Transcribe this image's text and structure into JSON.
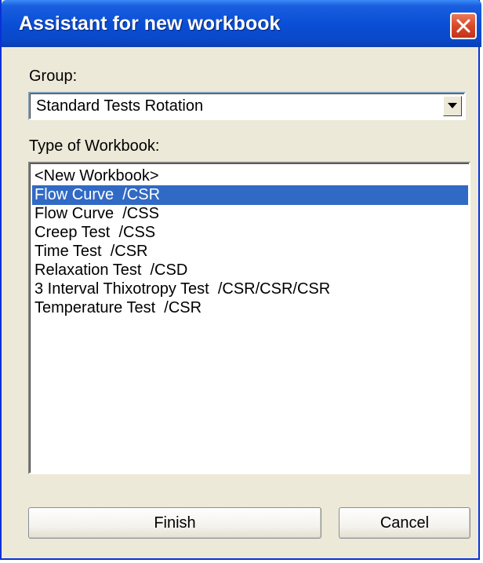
{
  "window": {
    "title": "Assistant for new workbook",
    "close_icon": "close-icon"
  },
  "group": {
    "label": "Group:",
    "selected_value": "Standard Tests Rotation"
  },
  "workbook_type": {
    "label": "Type of Workbook:",
    "items": [
      {
        "label": "<New Workbook>",
        "selected": false
      },
      {
        "label": "Flow Curve  /CSR",
        "selected": true
      },
      {
        "label": "Flow Curve  /CSS",
        "selected": false
      },
      {
        "label": "Creep Test  /CSS",
        "selected": false
      },
      {
        "label": "Time Test  /CSR",
        "selected": false
      },
      {
        "label": "Relaxation Test  /CSD",
        "selected": false
      },
      {
        "label": "3 Interval Thixotropy Test  /CSR/CSR/CSR",
        "selected": false
      },
      {
        "label": "Temperature Test  /CSR",
        "selected": false
      }
    ]
  },
  "buttons": {
    "finish_label": "Finish",
    "cancel_label": "Cancel"
  },
  "colors": {
    "titlebar": "#0a4fd6",
    "selection": "#316ac5",
    "window_bg": "#ece9d8",
    "close_button": "#d9492a"
  }
}
